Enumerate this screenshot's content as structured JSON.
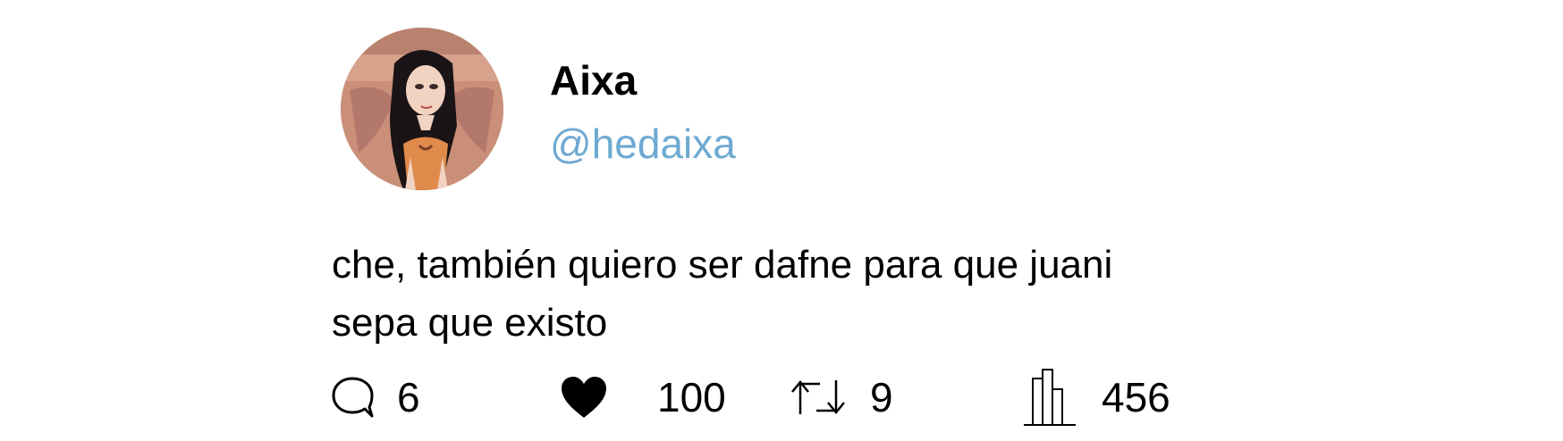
{
  "user": {
    "display_name": "Aixa",
    "handle": "@hedaixa",
    "handle_color": "#6ea9d2",
    "avatar": "avatar-illustration"
  },
  "tweet": {
    "lines": [
      "che, también quiero ser dafne para que juani",
      "sepa que existo"
    ]
  },
  "stats": {
    "replies": {
      "icon": "reply-bubble-icon",
      "count": "6"
    },
    "likes": {
      "icon": "heart-icon",
      "count": "100"
    },
    "retweets": {
      "icon": "retweet-icon",
      "count": "9"
    },
    "views": {
      "icon": "views-bars-icon",
      "count": "456"
    }
  }
}
